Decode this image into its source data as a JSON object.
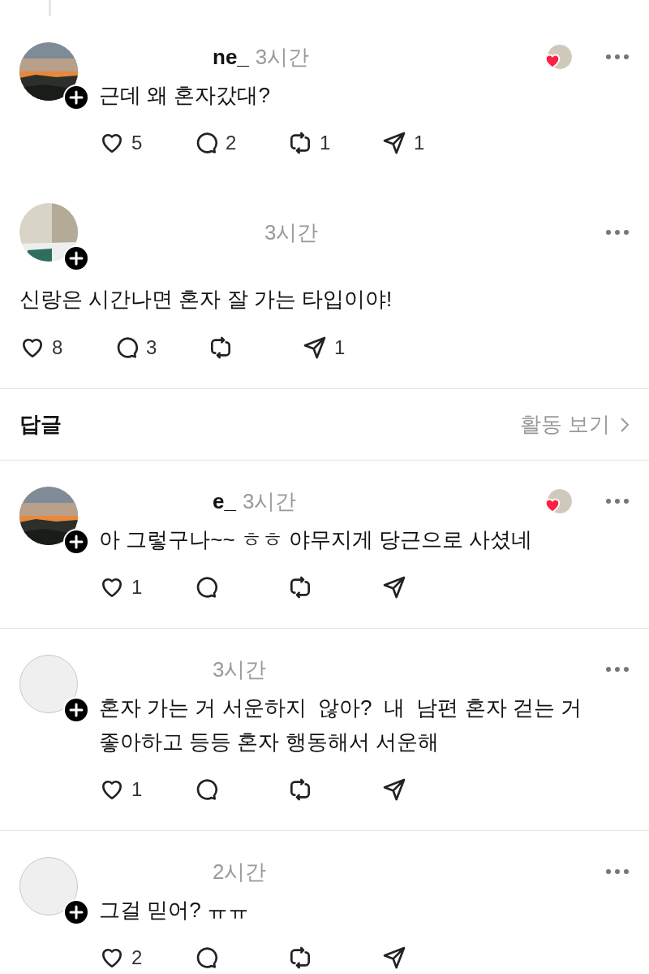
{
  "thread": [
    {
      "kind": "inline",
      "username": "ne_",
      "time": "3시간",
      "avatar": {
        "kind": "sunset"
      },
      "follow_badge": true,
      "author_liked": true,
      "text": "근데 왜 혼자갔대?",
      "actions": [
        {
          "kind": "like",
          "count": "5"
        },
        {
          "kind": "reply",
          "count": "2"
        },
        {
          "kind": "repost",
          "count": "1"
        },
        {
          "kind": "share",
          "count": "1"
        }
      ]
    },
    {
      "kind": "stacked",
      "time": "3시간",
      "follow_badge": true,
      "author_liked": false,
      "text": "신랑은 시간나면 혼자 잘 가는 타입이야!",
      "actions": [
        {
          "kind": "like",
          "count": "8"
        },
        {
          "kind": "reply",
          "count": "3"
        },
        {
          "kind": "repost"
        },
        {
          "kind": "share",
          "count": "1"
        }
      ]
    }
  ],
  "replies_header": {
    "title": "답글",
    "link": "활동 보기"
  },
  "replies": [
    {
      "kind": "inline",
      "username": "e_",
      "time": "3시간",
      "avatar": {
        "kind": "sunset"
      },
      "follow_badge": true,
      "author_liked": true,
      "text": "아 그렇구나~~ ㅎㅎ 야무지게 당근으로 사셨네",
      "actions": [
        {
          "kind": "like",
          "count": "1"
        },
        {
          "kind": "reply"
        },
        {
          "kind": "repost"
        },
        {
          "kind": "share"
        }
      ]
    },
    {
      "kind": "inline",
      "time": "3시간",
      "avatar": {
        "kind": "plain"
      },
      "follow_badge": true,
      "author_liked": false,
      "text": "혼자 가는 거 서운하지  않아?  내  남편 혼자 걷는 거 좋아하고 등등 혼자 행동해서 서운해",
      "actions": [
        {
          "kind": "like",
          "count": "1"
        },
        {
          "kind": "reply"
        },
        {
          "kind": "repost"
        },
        {
          "kind": "share"
        }
      ]
    },
    {
      "kind": "inline",
      "time": "2시간",
      "avatar": {
        "kind": "plain"
      },
      "follow_badge": true,
      "author_liked": false,
      "text": "그걸 믿어? ㅠㅠ",
      "actions": [
        {
          "kind": "like",
          "count": "2"
        },
        {
          "kind": "reply"
        },
        {
          "kind": "repost"
        },
        {
          "kind": "share"
        }
      ]
    }
  ]
}
